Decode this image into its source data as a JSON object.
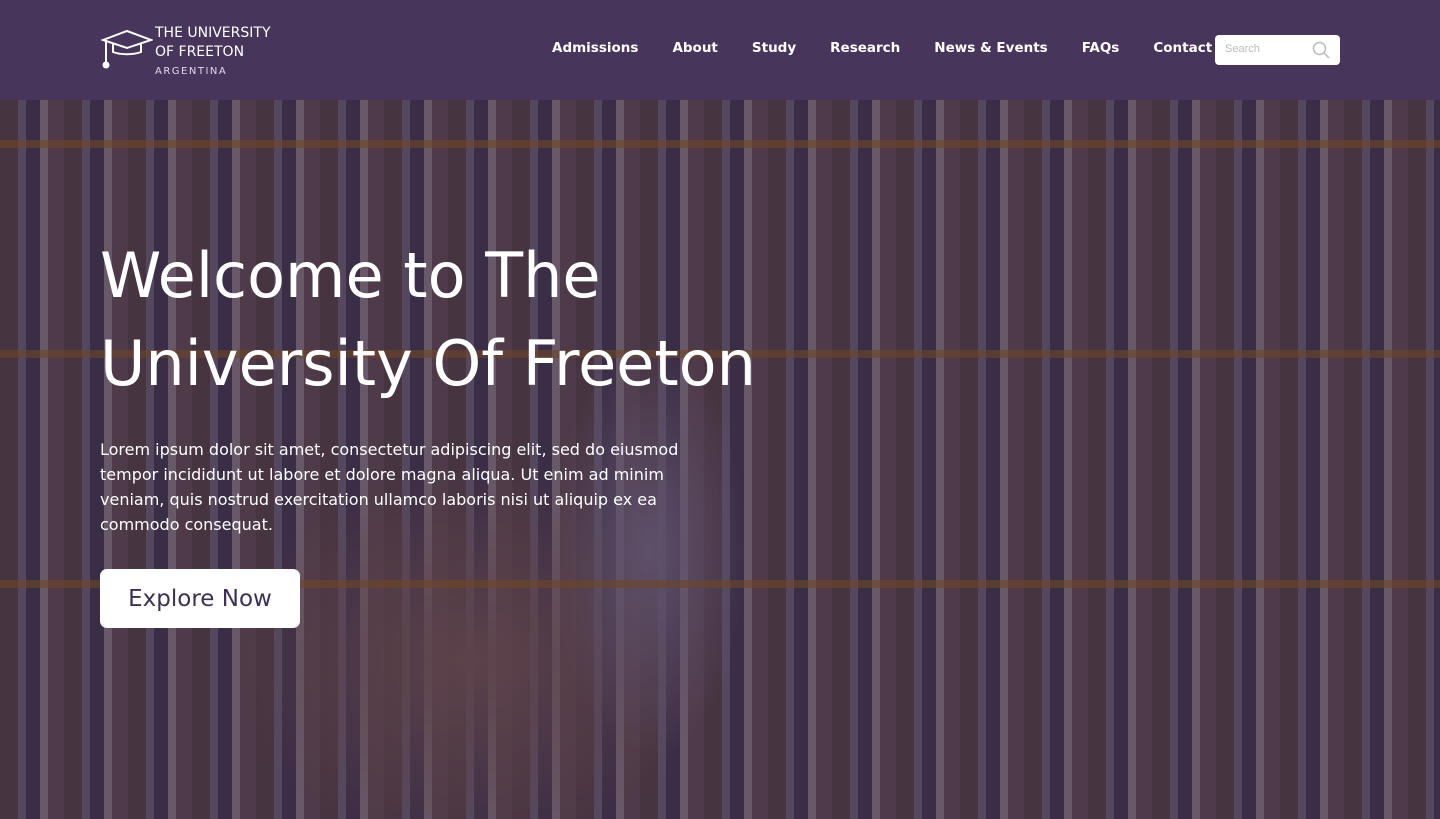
{
  "header": {
    "logo": {
      "line1": "THE UNIVERSITY",
      "line2": "OF FREETON",
      "line3": "ARGENTINA",
      "icon": "graduation-cap-icon"
    },
    "nav": [
      "Admissions",
      "About",
      "Study",
      "Research",
      "News & Events",
      "FAQs",
      "Contact Us"
    ],
    "search": {
      "placeholder": "Search",
      "value": "",
      "icon": "search-icon"
    }
  },
  "hero": {
    "title": "Welcome to The University Of Freeton",
    "text": "Lorem ipsum dolor sit amet, consectetur adipiscing elit, sed do eiusmod tempor incididunt ut labore et dolore magna aliqua. Ut enim ad minim veniam, quis nostrud exercitation ullamco laboris nisi ut aliquip ex ea commodo consequat.",
    "button": "Explore Now"
  },
  "colors": {
    "header": "#48355c",
    "button_text": "#3e3050"
  }
}
